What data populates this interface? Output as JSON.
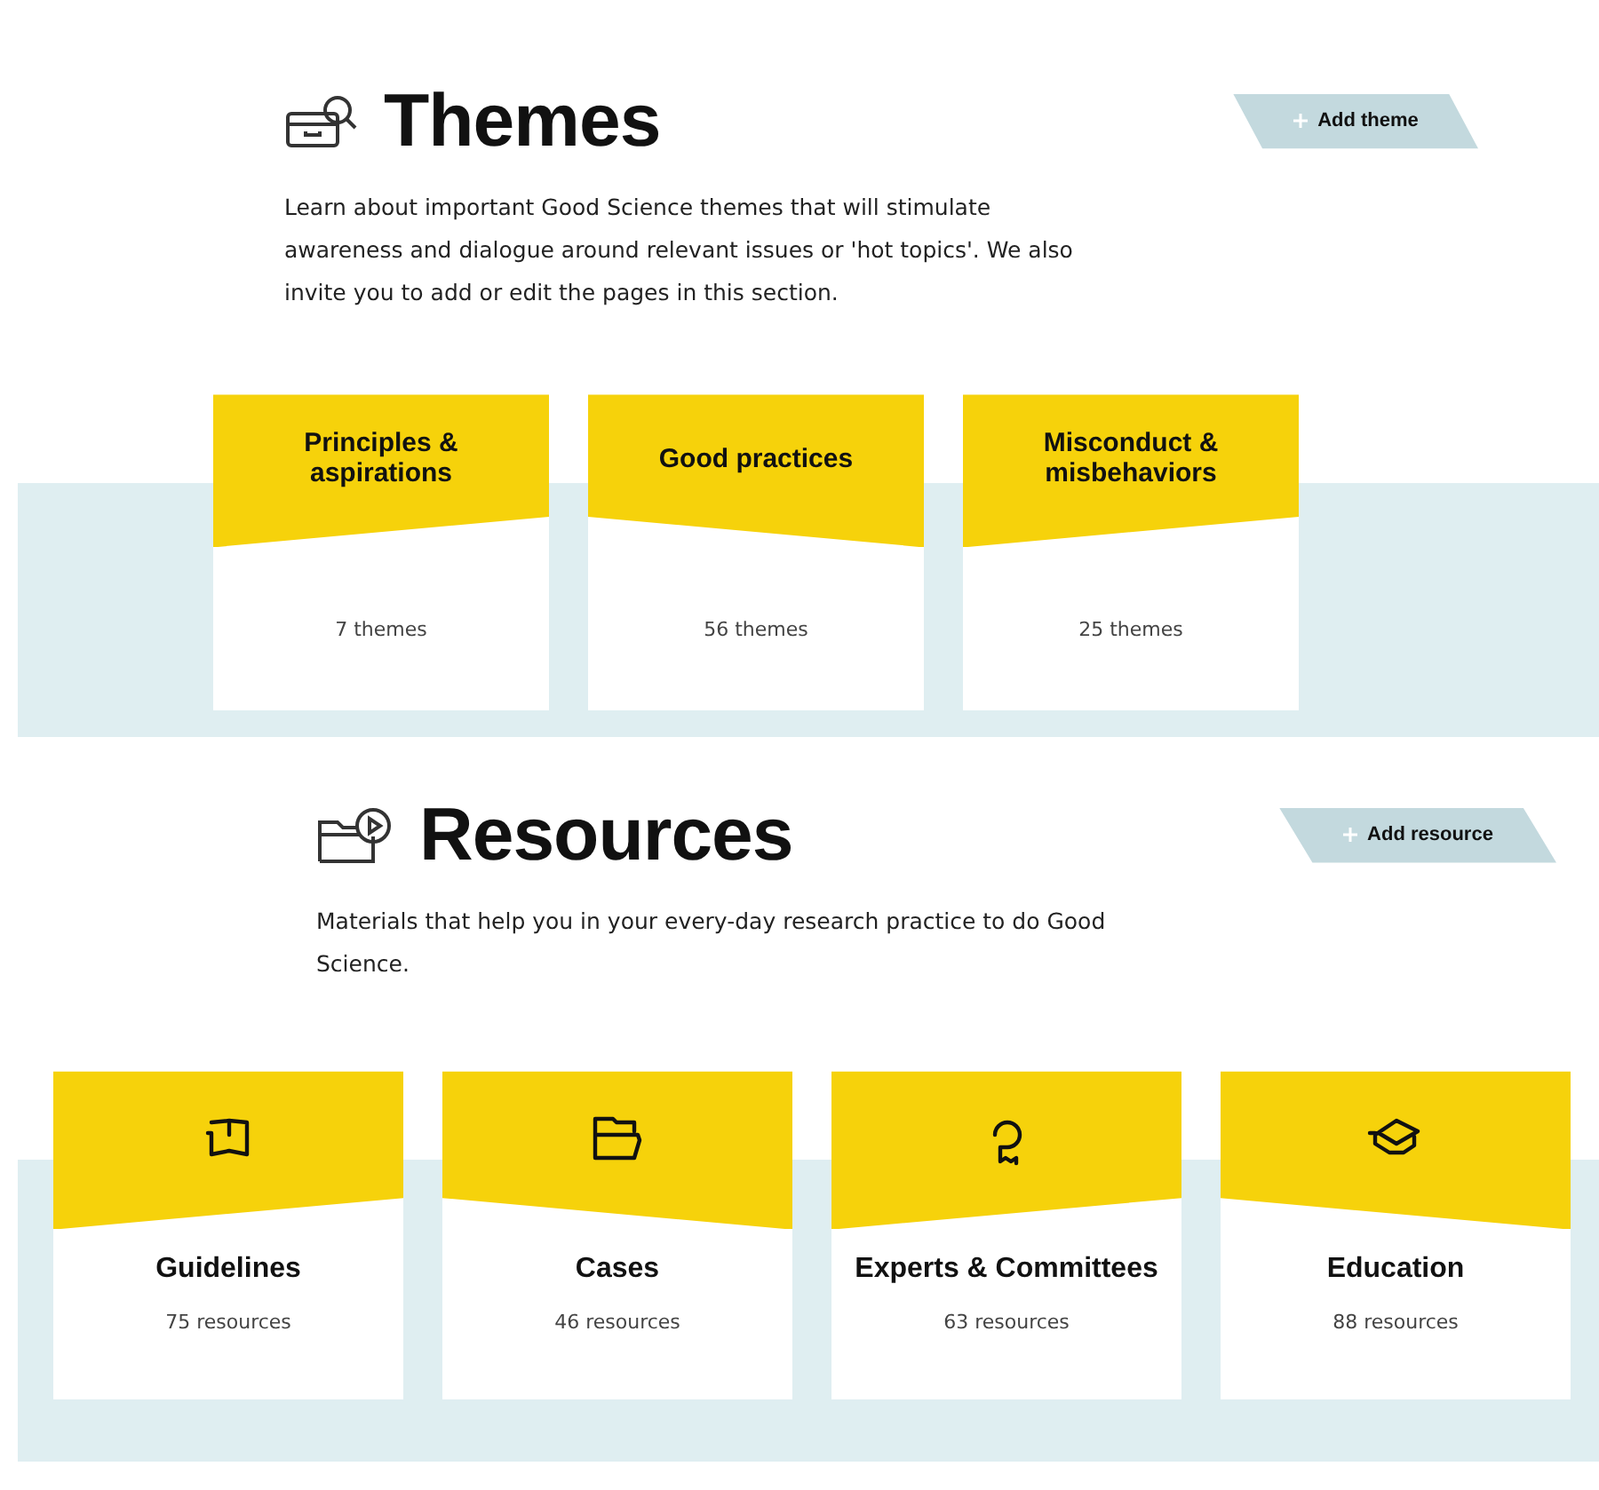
{
  "themes": {
    "title": "Themes",
    "add_button": "Add theme",
    "description": "Learn about important Good Science themes that will stimulate awareness and dialogue around relevant issues or 'hot topics'. We also invite you to add or edit the pages in this section.",
    "cards": [
      {
        "title": "Principles & aspirations",
        "count": "7 themes"
      },
      {
        "title": "Good practices",
        "count": "56 themes"
      },
      {
        "title": "Misconduct & misbehaviors",
        "count": "25 themes"
      }
    ]
  },
  "resources": {
    "title": "Resources",
    "add_button": "Add resource",
    "description": "Materials that help you in your every-day research practice to do Good Science.",
    "cards": [
      {
        "title": "Guidelines",
        "count": "75 resources"
      },
      {
        "title": "Cases",
        "count": "46 resources"
      },
      {
        "title": "Experts & Committees",
        "count": "63 resources"
      },
      {
        "title": "Education",
        "count": "88 resources"
      }
    ]
  }
}
